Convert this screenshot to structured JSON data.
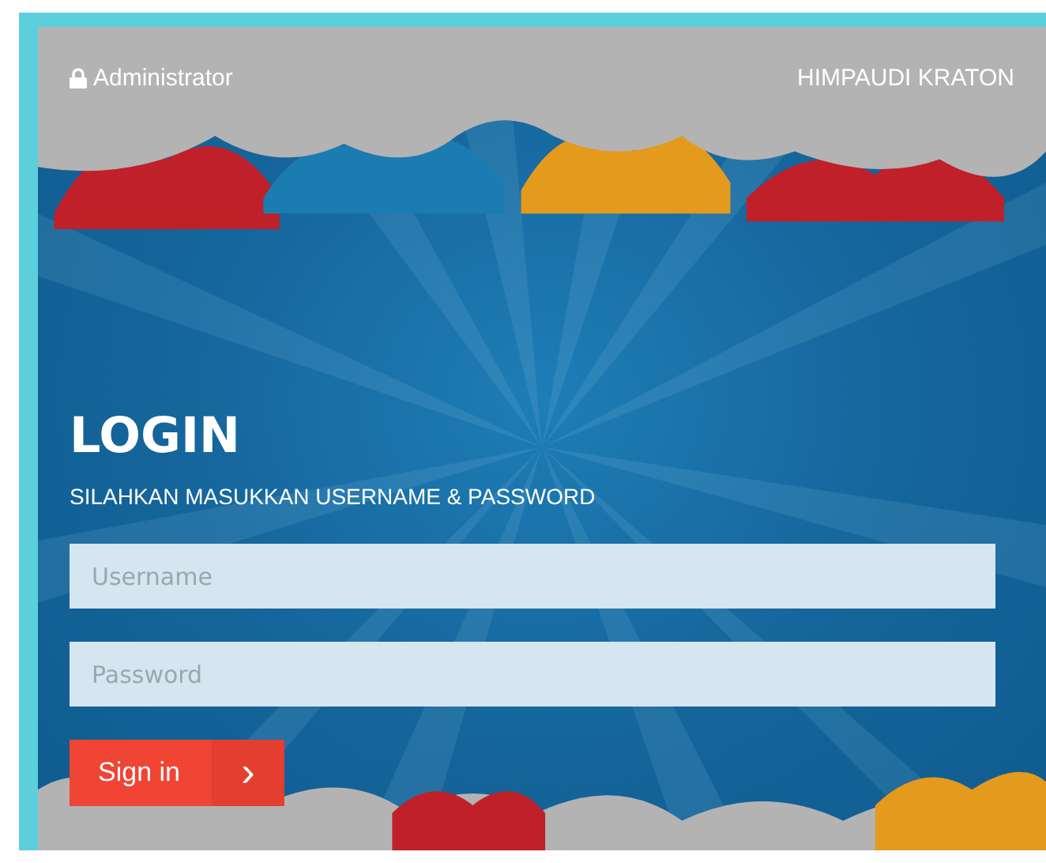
{
  "header": {
    "user": "Administrator",
    "site": "HIMPAUDI KRATON"
  },
  "login": {
    "title": "LOGIN",
    "subtitle": "SILAHKAN MASUKKAN USERNAME & PASSWORD",
    "fields": [
      {
        "placeholder": "Username"
      },
      {
        "placeholder": "Password"
      }
    ],
    "button": {
      "label": "Sign in",
      "arrow": "›"
    }
  }
}
